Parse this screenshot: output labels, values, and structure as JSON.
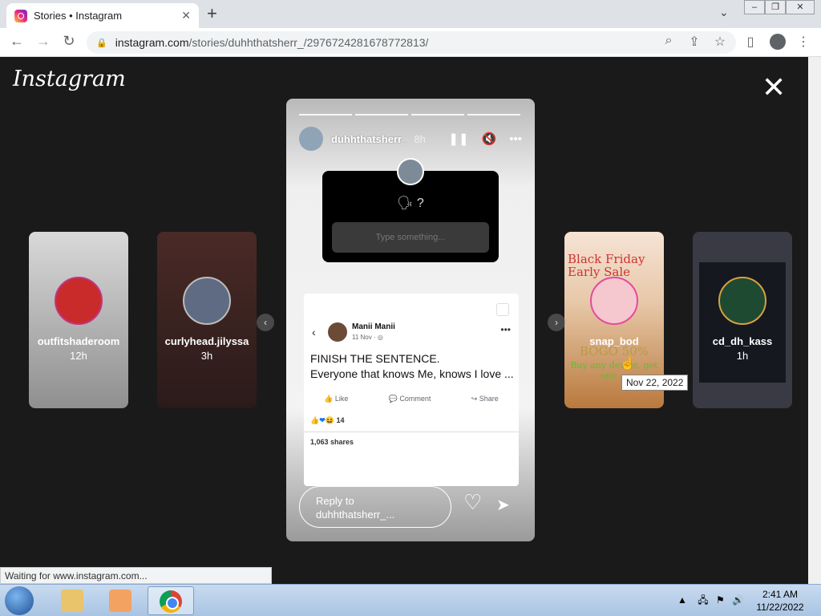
{
  "browser": {
    "tab_title": "Stories • Instagram",
    "tab_close": "✕",
    "new_tab": "+",
    "tablist": "⌄",
    "url_host": "instagram.com",
    "url_path": "/stories/duhhthatsherr_/2976724281678772813/",
    "status_text": "Waiting for www.instagram.com..."
  },
  "page": {
    "logo": "Instagram",
    "close": "✕",
    "left_stories": [
      {
        "username": "outfitshaderoom",
        "age": "12h"
      },
      {
        "username": "curlyhead.jilyssa",
        "age": "3h"
      }
    ],
    "right_stories": [
      {
        "username": "snap_bod",
        "age": "",
        "overlay_title": "Black Friday Early Sale",
        "overlay_promo": "BOGO 50%",
        "overlay_sub": "Buy any device, get one ..."
      },
      {
        "username": "cd_dh_kass",
        "age": "1h"
      }
    ],
    "tooltip": "Nov 22, 2022",
    "prev_arrow": "‹",
    "next_arrow": "›"
  },
  "story": {
    "username": "duhhthatsherr_",
    "age": "8h",
    "question_text": "? ",
    "question_emoji": "🗣",
    "input_placeholder": "Type something...",
    "post": {
      "author": "Manii Manii",
      "date": "11 Nov · ◎",
      "line1": "FINISH THE SENTENCE.",
      "line2": "Everyone that knows Me, knows I love ...",
      "like": "Like",
      "comment": "Comment",
      "share": "Share",
      "reactions": "14",
      "shares": "1,063 shares"
    },
    "reply_placeholder": "Reply to duhhthatsherr_..."
  },
  "taskbar": {
    "time": "2:41 AM",
    "date": "11/22/2022"
  }
}
